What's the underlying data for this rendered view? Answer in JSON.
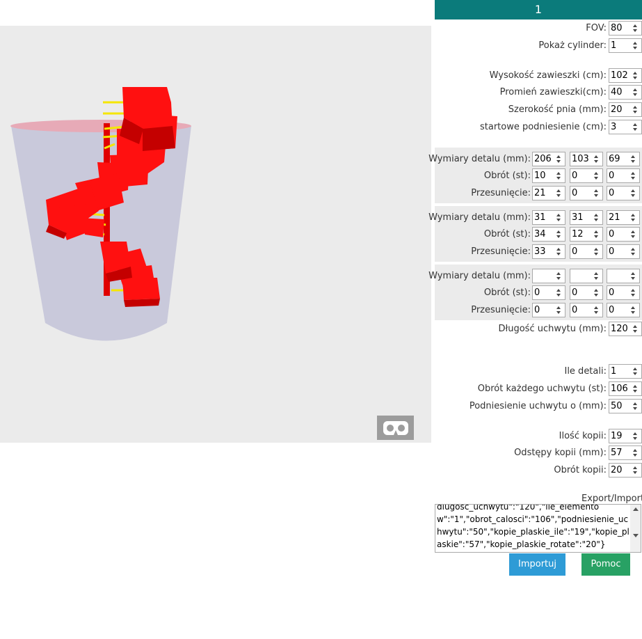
{
  "header": {
    "title": "1"
  },
  "viewport": {
    "vr_icon": "vr-headset-icon"
  },
  "settings": {
    "fov": {
      "label": "FOV",
      "value": "80"
    },
    "show_cylinder": {
      "label": "Pokaż cylinder",
      "value": "1"
    },
    "hanger_height": {
      "label": "Wysokość zawieszki (cm)",
      "value": "102"
    },
    "hanger_radius": {
      "label": "Promień zawieszki(cm)",
      "value": "40"
    },
    "trunk_width": {
      "label": "Szerokość pnia (mm)",
      "value": "20"
    },
    "start_lift": {
      "label": "startowe podniesienie (cm)",
      "value": "3"
    }
  },
  "details": [
    {
      "dims": {
        "label": "Wymiary detalu (mm)",
        "values": [
          "206",
          "103",
          "69"
        ]
      },
      "rotation": {
        "label": "Obrót (st)",
        "values": [
          "10",
          "0",
          "0"
        ]
      },
      "shift": {
        "label": "Przesunięcie",
        "values": [
          "21",
          "0",
          "0"
        ]
      }
    },
    {
      "dims": {
        "label": "Wymiary detalu (mm)",
        "values": [
          "31",
          "31",
          "21"
        ]
      },
      "rotation": {
        "label": "Obrót (st)",
        "values": [
          "34",
          "12",
          "0"
        ]
      },
      "shift": {
        "label": "Przesunięcie",
        "values": [
          "33",
          "0",
          "0"
        ]
      }
    },
    {
      "dims": {
        "label": "Wymiary detalu (mm)",
        "values": [
          "",
          "",
          ""
        ]
      },
      "rotation": {
        "label": "Obrót (st)",
        "values": [
          "0",
          "0",
          "0"
        ]
      },
      "shift": {
        "label": "Przesunięcie",
        "values": [
          "0",
          "0",
          "0"
        ]
      }
    }
  ],
  "handle": {
    "length": {
      "label": "Długość uchwytu (mm)",
      "value": "120"
    },
    "count": {
      "label": "Ile detali",
      "value": "1"
    },
    "rotation_each": {
      "label": "Obrót każdego uchwytu (st)",
      "value": "106"
    },
    "lift_each": {
      "label": "Podniesienie uchwytu o (mm)",
      "value": "50"
    }
  },
  "copies": {
    "count": {
      "label": "Ilość kopii",
      "value": "19"
    },
    "spacing": {
      "label": "Odstępy kopii (mm)",
      "value": "57"
    },
    "rotation": {
      "label": "Obrót kopii",
      "value": "20"
    }
  },
  "export": {
    "label": "Export/Import",
    "text": "dlugosc_uchwytu\":\"120\",\"ile_elementow\":\"1\",\"obrot_calosci\":\"106\",\"podniesienie_uchwytu\":\"50\",\"kopie_plaskie_ile\":\"19\",\"kopie_plaskie\":\"57\",\"kopie_plaskie_rotate\":\"20\"}"
  },
  "buttons": {
    "import_label": "Importuj",
    "help_label": "Pomoc"
  }
}
